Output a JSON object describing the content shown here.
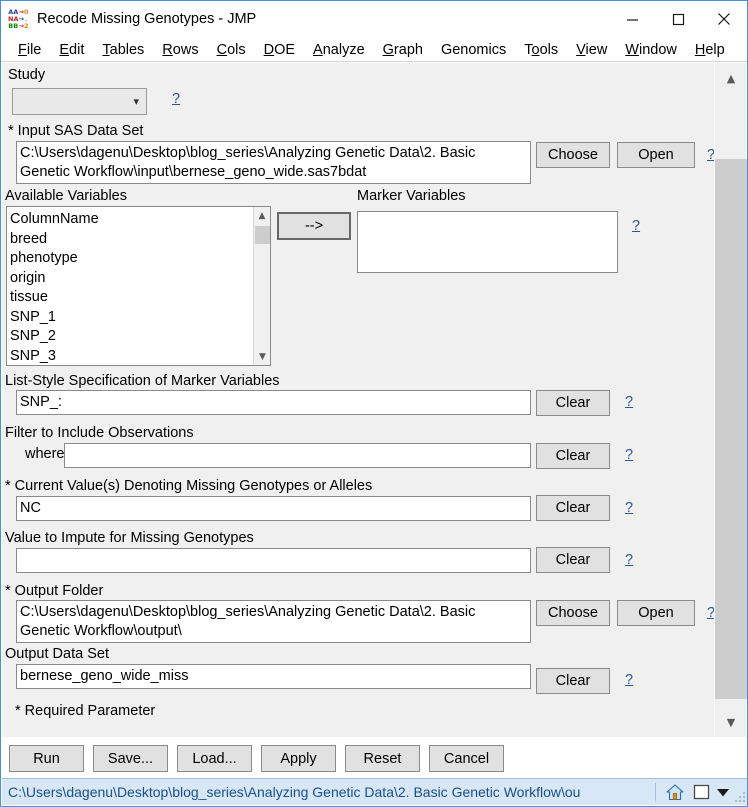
{
  "window": {
    "title": "Recode Missing Genotypes - JMP",
    "icon": "jmp-genomics-icon",
    "controls": {
      "minimize": "minimize-icon",
      "maximize": "maximize-icon",
      "close": "close-icon"
    }
  },
  "menubar": {
    "items": [
      {
        "label": "File",
        "accel": "F"
      },
      {
        "label": "Edit",
        "accel": "E"
      },
      {
        "label": "Tables",
        "accel": "T"
      },
      {
        "label": "Rows",
        "accel": "R"
      },
      {
        "label": "Cols",
        "accel": "C"
      },
      {
        "label": "DOE",
        "accel": "D"
      },
      {
        "label": "Analyze",
        "accel": "A"
      },
      {
        "label": "Graph",
        "accel": "G"
      },
      {
        "label": "Genomics",
        "accel": ""
      },
      {
        "label": "Tools",
        "accel": "o"
      },
      {
        "label": "View",
        "accel": "V"
      },
      {
        "label": "Window",
        "accel": "W"
      },
      {
        "label": "Help",
        "accel": "H"
      }
    ]
  },
  "form": {
    "study": {
      "label": "Study",
      "value": "",
      "help": "?"
    },
    "input_data_set": {
      "label": "* Input SAS Data Set",
      "value": "C:\\Users\\dagenu\\Desktop\\blog_series\\Analyzing Genetic Data\\2. Basic Genetic Workflow\\input\\bernese_geno_wide.sas7bdat",
      "choose_label": "Choose",
      "open_label": "Open",
      "help": "?"
    },
    "available_variables": {
      "label": "Available Variables",
      "items": [
        "ColumnName",
        "breed",
        "phenotype",
        "origin",
        "tissue",
        "SNP_1",
        "SNP_2",
        "SNP_3"
      ]
    },
    "move_button": {
      "label": "-->"
    },
    "marker_variables": {
      "label": "Marker Variables",
      "items": [],
      "help": "?"
    },
    "list_style_spec": {
      "label": "List-Style Specification of Marker Variables",
      "value": "SNP_:",
      "clear_label": "Clear",
      "help": "?"
    },
    "filter": {
      "label": "Filter to Include Observations",
      "where_label": "where",
      "value": "",
      "clear_label": "Clear",
      "help": "?"
    },
    "missing_values": {
      "label": "* Current Value(s) Denoting Missing Genotypes or Alleles",
      "value": "NC",
      "clear_label": "Clear",
      "help": "?"
    },
    "impute_value": {
      "label": "Value to Impute for Missing Genotypes",
      "value": "",
      "clear_label": "Clear",
      "help": "?"
    },
    "output_folder": {
      "label": "* Output Folder",
      "value": "C:\\Users\\dagenu\\Desktop\\blog_series\\Analyzing Genetic Data\\2. Basic Genetic Workflow\\output\\",
      "choose_label": "Choose",
      "open_label": "Open",
      "help": "?"
    },
    "output_data_set": {
      "label": "Output Data Set",
      "value": "bernese_geno_wide_miss",
      "clear_label": "Clear",
      "help": "?"
    }
  },
  "footer": {
    "required_note": "* Required Parameter",
    "buttons": [
      {
        "label": "Run"
      },
      {
        "label": "Save..."
      },
      {
        "label": "Load..."
      },
      {
        "label": "Apply"
      },
      {
        "label": "Reset"
      },
      {
        "label": "Cancel"
      }
    ]
  },
  "statusbar": {
    "text": "C:\\Users\\dagenu\\Desktop\\blog_series\\Analyzing Genetic Data\\2. Basic Genetic Workflow\\ou",
    "home_icon": "home-icon",
    "window-icon": "window-icon",
    "dropdown_icon": "caret-down-icon"
  },
  "colors": {
    "accent_border": "#4a90d9",
    "status_bg": "#d7e7f5",
    "status_text": "#1a4f8a",
    "link": "#2b5797",
    "panel_bg": "#f0f0f0"
  }
}
